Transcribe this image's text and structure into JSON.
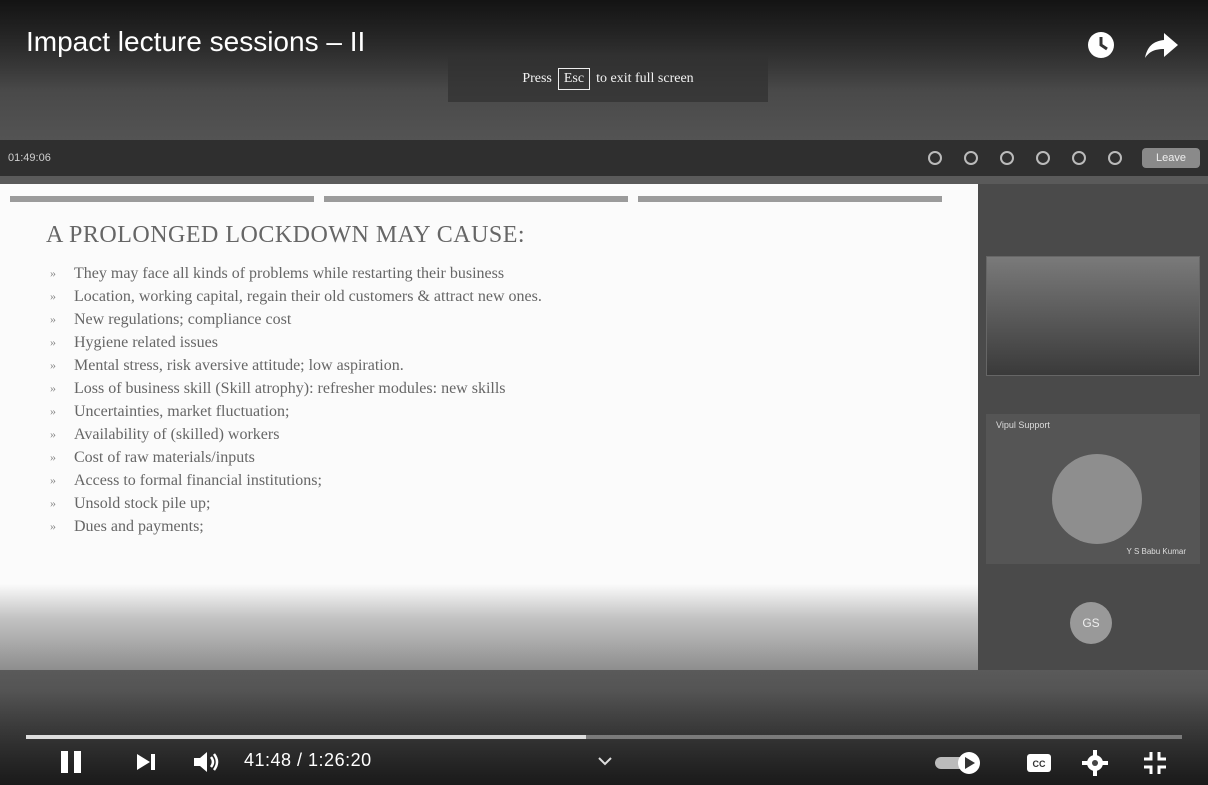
{
  "video": {
    "title": "Impact lecture sessions – II",
    "fullscreen_hint": {
      "press": "Press",
      "key": "Esc",
      "rest": "to exit full screen"
    },
    "time": "41:48 / 1:26:20",
    "progress": 0.484
  },
  "meeting": {
    "left_text": "01:49:06",
    "leave_label": "Leave"
  },
  "slide": {
    "heading": "A PROLONGED LOCKDOWN MAY CAUSE:",
    "bullet_symbol": "»",
    "bullets": [
      "They may face all kinds of problems while restarting their business",
      "Location, working capital, regain their old customers & attract new ones.",
      "New regulations; compliance cost",
      "Hygiene related issues",
      "Mental stress, risk aversive attitude; low aspiration.",
      "Loss of business skill (Skill atrophy): refresher modules: new skills",
      "Uncertainties, market fluctuation;",
      "Availability of (skilled) workers",
      "Cost of raw materials/inputs",
      "Access to formal financial institutions;",
      "Unsold stock pile up;",
      "Dues and payments;"
    ]
  },
  "participants": {
    "tile_label": "Vipul Support",
    "tile_name": "Y S Babu Kumar",
    "avatar2": "GS"
  },
  "icons": {
    "clock": "watch-later-icon",
    "share": "share-icon",
    "pause": "pause-icon",
    "next": "next-icon",
    "volume": "volume-icon",
    "autoplay": "autoplay-toggle-icon",
    "cc": "captions-icon",
    "settings": "gear-icon",
    "exit_fullscreen": "exit-fullscreen-icon"
  }
}
